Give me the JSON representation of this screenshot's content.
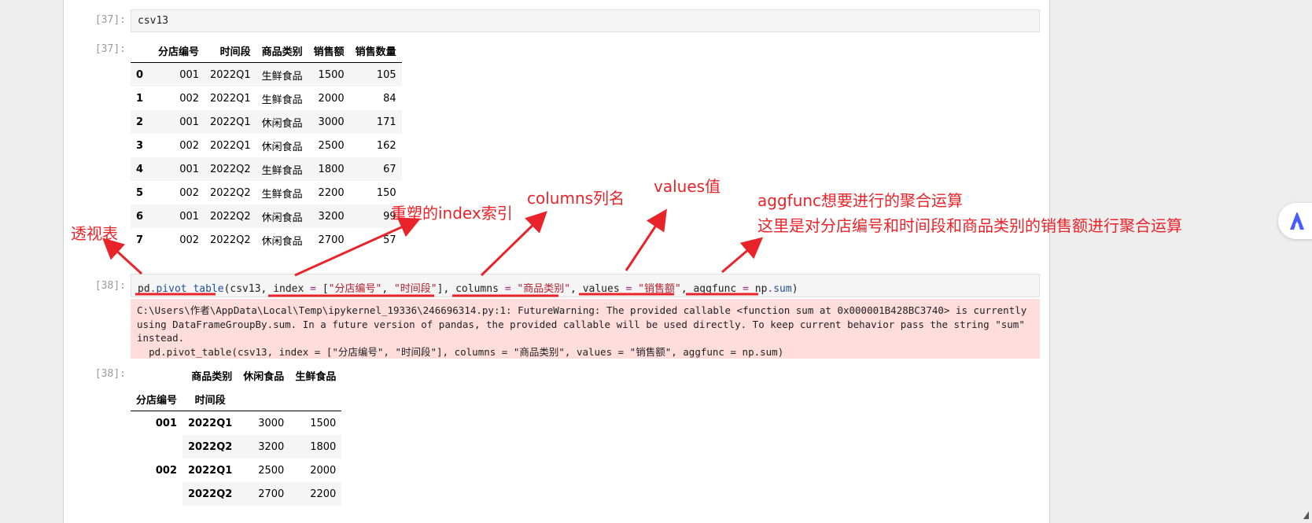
{
  "cells": {
    "input37": {
      "prompt": "[37]:",
      "code": "csv13"
    },
    "output37": {
      "prompt": "[37]:",
      "columns": [
        "",
        "分店编号",
        "时间段",
        "商品类别",
        "销售额",
        "销售数量"
      ],
      "rows": [
        [
          "0",
          "001",
          "2022Q1",
          "生鲜食品",
          "1500",
          "105"
        ],
        [
          "1",
          "002",
          "2022Q1",
          "生鲜食品",
          "2000",
          "84"
        ],
        [
          "2",
          "001",
          "2022Q1",
          "休闲食品",
          "3000",
          "171"
        ],
        [
          "3",
          "002",
          "2022Q1",
          "休闲食品",
          "2500",
          "162"
        ],
        [
          "4",
          "001",
          "2022Q2",
          "生鲜食品",
          "1800",
          "67"
        ],
        [
          "5",
          "002",
          "2022Q2",
          "生鲜食品",
          "2200",
          "150"
        ],
        [
          "6",
          "001",
          "2022Q2",
          "休闲食品",
          "3200",
          "99"
        ],
        [
          "7",
          "002",
          "2022Q2",
          "休闲食品",
          "2700",
          "57"
        ]
      ]
    },
    "input38": {
      "prompt": "[38]:",
      "tokens": {
        "pd": "pd",
        "dot": ".",
        "fn": "pivot_table",
        "open": "(csv13, ",
        "index_kw": "index",
        "eq1": " = ",
        "index_val_open": "[",
        "index_s1": "\"分店编号\"",
        "comma1": ", ",
        "index_s2": "\"时间段\"",
        "index_val_close": "]",
        "comma2": ", ",
        "columns_kw": "columns",
        "eq2": " = ",
        "columns_val": "\"商品类别\"",
        "comma3": ", ",
        "values_kw": "values",
        "eq3": " = ",
        "values_val": "\"销售额\"",
        "comma4": ", ",
        "aggfunc_kw": "aggfunc",
        "eq4": " = ",
        "np": "np",
        "dot2": ".",
        "sum": "sum",
        "close": ")"
      }
    },
    "warning38": {
      "text": "C:\\Users\\作者\\AppData\\Local\\Temp\\ipykernel_19336\\246696314.py:1: FutureWarning: The provided callable <function sum at 0x000001B428BC3740> is currently using DataFrameGroupBy.sum. In a future version of pandas, the provided callable will be used directly. To keep current behavior pass the string \"sum\" instead.\n  pd.pivot_table(csv13, index = [\"分店编号\", \"时间段\"], columns = \"商品类别\", values = \"销售额\", aggfunc = np.sum)"
    },
    "output38": {
      "prompt": "[38]:",
      "col_level_name": "商品类别",
      "col_headers": [
        "休闲食品",
        "生鲜食品"
      ],
      "index_names": [
        "分店编号",
        "时间段"
      ],
      "rows": [
        {
          "store": "001",
          "period": "2022Q1",
          "values": [
            "3000",
            "1500"
          ]
        },
        {
          "store": "",
          "period": "2022Q2",
          "values": [
            "3200",
            "1800"
          ]
        },
        {
          "store": "002",
          "period": "2022Q1",
          "values": [
            "2500",
            "2000"
          ]
        },
        {
          "store": "",
          "period": "2022Q2",
          "values": [
            "2700",
            "2200"
          ]
        }
      ]
    }
  },
  "annotations": {
    "pivot": "透视表",
    "index": "重塑的index索引",
    "columns": "columns列名",
    "values": "values值",
    "aggfunc_line1": "aggfunc想要进行的聚合运算",
    "aggfunc_line2": "这里是对分店编号和时间段和商品类别的销售额进行聚合运算"
  },
  "colors": {
    "annotation": "#e8242a",
    "warning_bg": "#ffdddd",
    "input_bg": "#f5f5f5",
    "side_widget_accent": "#4a5bff"
  },
  "icons": {
    "side_widget": "assistant-logo-icon"
  }
}
